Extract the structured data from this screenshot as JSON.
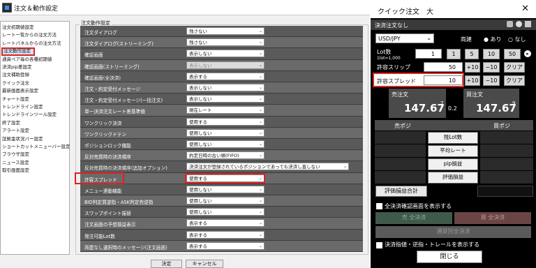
{
  "dialog": {
    "title": "注文＆動作設定",
    "group_label": "注文動作設定",
    "ok": "決定",
    "cancel": "キャンセル"
  },
  "sidebar": [
    "注文初期値設定",
    "レート一覧からの注文方法",
    "レートパネルからの注文方法",
    "注文動作設定",
    "通貨ペア毎の各種初期値",
    "決済pip差設定",
    "注文補助登録",
    "クイック注文",
    "最新画面表示設定",
    "チャート設定",
    "トレンドライン設定",
    "トレンドラインツール設定",
    "終了設定",
    "アラート設定",
    "証拠金状況バー設定",
    "ショートカットメニューバー設定",
    "ブラウザ設定",
    "ニュース設定",
    "取引画面設定"
  ],
  "rows": [
    {
      "label": "注文ダイアログ",
      "value": "残さない"
    },
    {
      "label": "注文ダイアログ(ストリーミング)",
      "value": "残さない"
    },
    {
      "label": "確認画面",
      "value": "表示しない"
    },
    {
      "label": "確認画面(ストリーミング)",
      "value": "表示しない"
    },
    {
      "label": "確認画面(全決済)",
      "value": "表示する"
    },
    {
      "label": "注文・約定受付メッセージ",
      "value": "表示しない"
    },
    {
      "label": "注文・約定受付メッセージ(一括注文)",
      "value": "表示しない"
    },
    {
      "label": "単一決済注文レート差基準値",
      "value": "現在レート"
    },
    {
      "label": "ワンクリック決済",
      "value": "使用する"
    },
    {
      "label": "ワンクリックドテン",
      "value": "使用しない"
    },
    {
      "label": "ポジションロック機能",
      "value": "使用しない"
    },
    {
      "label": "反対売買時の決済順序",
      "value": "約定日時の古い順(FIFO)"
    },
    {
      "label": "反対売買時の決済順序(追加オプション)",
      "value": "決済注文が登録されているポジションであっても決済し直しない"
    },
    {
      "label": "許容スプレッド",
      "value": "使用する"
    },
    {
      "label": "メニュー連動機能",
      "value": "使用しない"
    },
    {
      "label": "BID判定買逆指・ASK判定売逆指",
      "value": "使用しない"
    },
    {
      "label": "スワップポイント振替",
      "value": "使用しない"
    },
    {
      "label": "注文画面の予想損益表示",
      "value": "表示する"
    },
    {
      "label": "発注可能Lot数",
      "value": "表示する"
    },
    {
      "label": "両建なし選択時のメッセージ(注文画面)",
      "value": "表示する"
    }
  ],
  "quick": {
    "title": "クイック注文　大",
    "mode": "決済注文なし",
    "pair": "USD/JPY",
    "hedge_label": "両建",
    "hedge_on": "あり",
    "hedge_off": "なし",
    "lot_label": "Lot数",
    "lot_sub": "1lot=1,000",
    "lot_value": "1",
    "lot_btns": [
      "1",
      "5",
      "10",
      "50"
    ],
    "slip_label": "許容スリップ",
    "slip_value": "50",
    "spread_label": "許容スプレッド",
    "spread_value": "10",
    "plus10": "+10",
    "minus10": "−10",
    "clear": "クリア",
    "sell_label": "売注文",
    "sell_main": "147.67",
    "sell_sup": "7",
    "buy_label": "買注文",
    "buy_main": "147.67",
    "buy_sup": "9",
    "spread": "0.2",
    "sell_pos": "売ポジ",
    "buy_pos": "買ポジ",
    "table": [
      "残Lot数",
      "平均レート",
      "pip損益",
      "評価損益"
    ],
    "total_label": "評価損益合計",
    "show_confirm": "全決済確認画面を表示する",
    "sell_all": "売 全決済",
    "buy_all": "買 全決済",
    "ccy_all": "通貨別全決済",
    "show_orders": "決済指値・逆指・トレールを表示する",
    "close": "閉じる"
  }
}
